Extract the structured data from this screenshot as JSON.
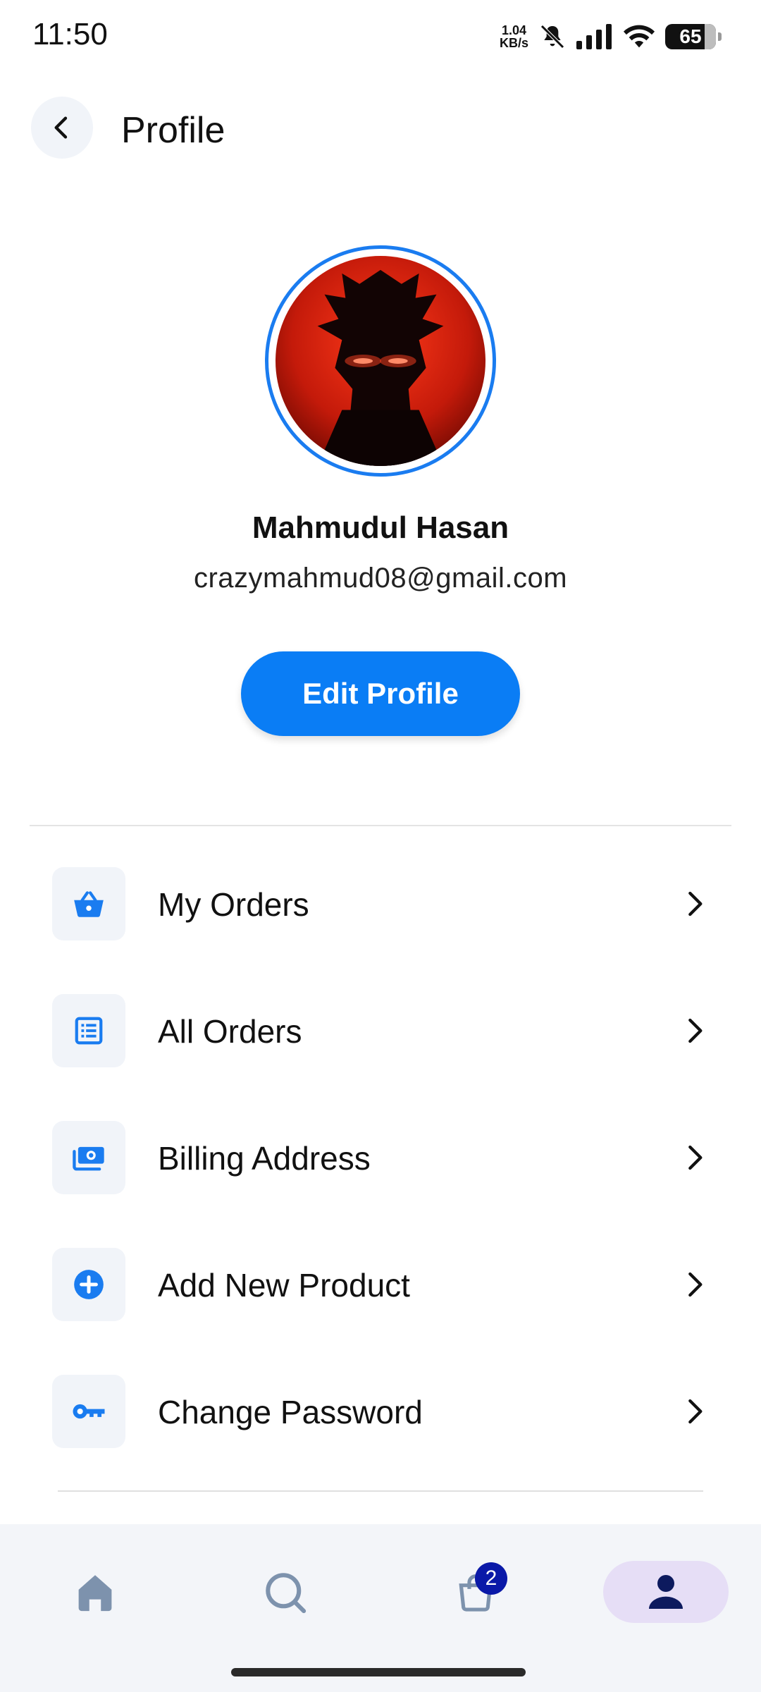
{
  "status_bar": {
    "time": "11:50",
    "net_speed_value": "1.04",
    "net_speed_unit": "KB/s",
    "battery": "65"
  },
  "header": {
    "title": "Profile"
  },
  "profile": {
    "name": "Mahmudul Hasan",
    "email": "crazymahmud08@gmail.com",
    "edit_label": "Edit Profile"
  },
  "menu": {
    "items": [
      {
        "label": "My Orders",
        "icon": "basket-icon"
      },
      {
        "label": "All Orders",
        "icon": "list-icon"
      },
      {
        "label": "Billing Address",
        "icon": "money-icon"
      },
      {
        "label": "Add New Product",
        "icon": "plus-circle-icon"
      },
      {
        "label": "Change Password",
        "icon": "key-icon"
      }
    ]
  },
  "bottom_nav": {
    "items": [
      "home-icon",
      "search-icon",
      "cart-icon",
      "profile-icon"
    ],
    "cart_badge": "2",
    "active": "profile"
  },
  "colors": {
    "accent": "#0a7df5",
    "icon_blue": "#1a7cf0",
    "nav_active_bg": "#e6def6",
    "nav_active_icon": "#0d1a5e",
    "badge": "#0a19a8"
  }
}
